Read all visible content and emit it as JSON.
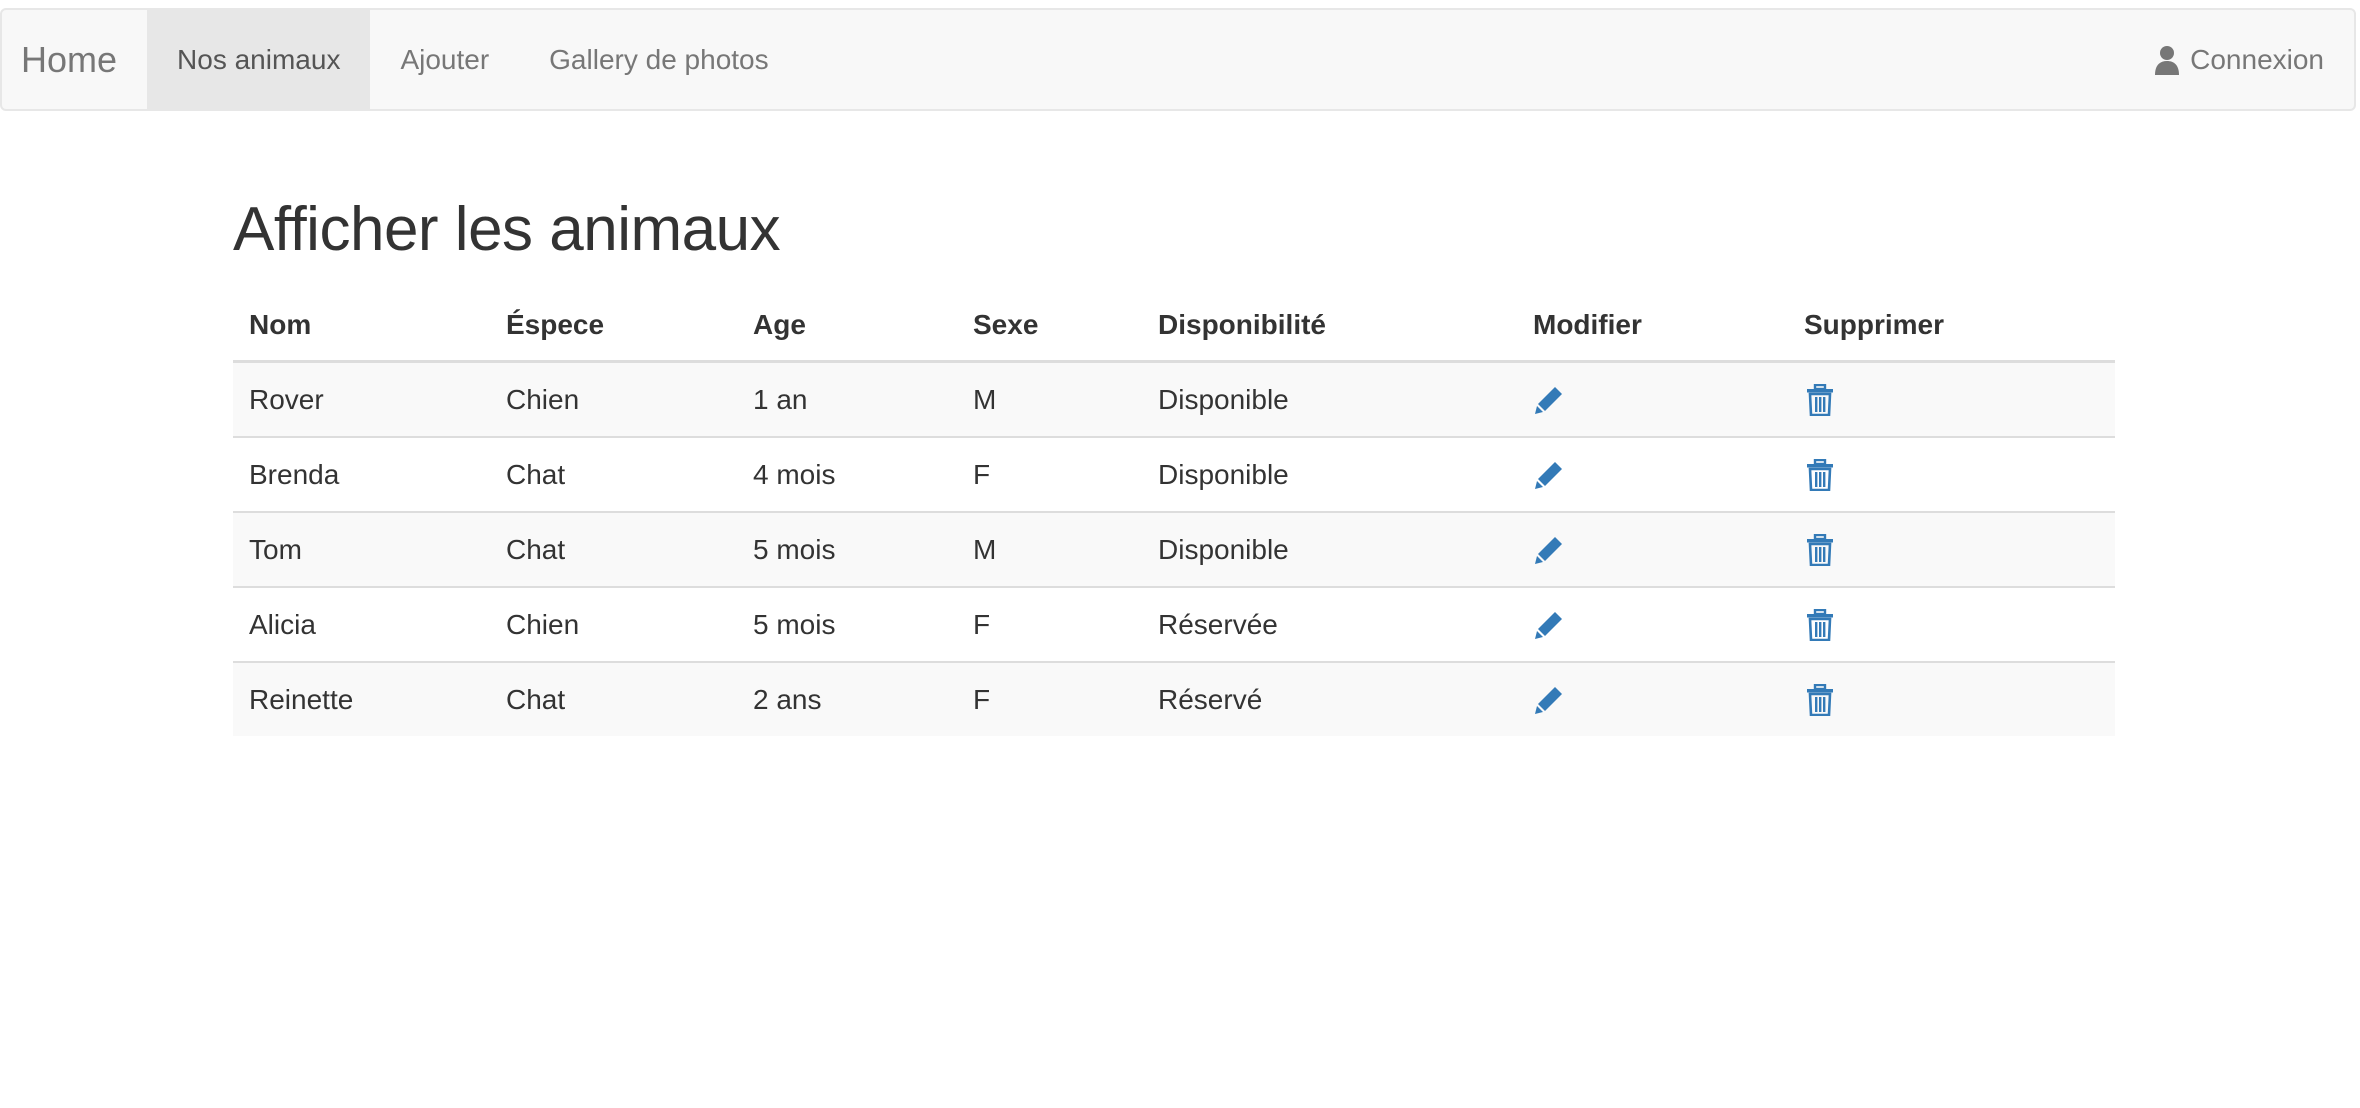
{
  "navbar": {
    "brand": "Home",
    "items": [
      {
        "label": "Nos animaux",
        "active": true
      },
      {
        "label": "Ajouter",
        "active": false
      },
      {
        "label": "Gallery de photos",
        "active": false
      }
    ],
    "login_label": "Connexion",
    "login_icon": "user-icon"
  },
  "main": {
    "title": "Afficher les animaux",
    "table": {
      "headers": [
        "Nom",
        "Éspece",
        "Age",
        "Sexe",
        "Disponibilité",
        "Modifier",
        "Supprimer"
      ],
      "rows": [
        {
          "nom": "Rover",
          "espece": "Chien",
          "age": "1 an",
          "sexe": "M",
          "disponibilite": "Disponible"
        },
        {
          "nom": "Brenda",
          "espece": "Chat",
          "age": "4 mois",
          "sexe": "F",
          "disponibilite": "Disponible"
        },
        {
          "nom": "Tom",
          "espece": "Chat",
          "age": "5 mois",
          "sexe": "M",
          "disponibilite": "Disponible"
        },
        {
          "nom": "Alicia",
          "espece": "Chien",
          "age": "5 mois",
          "sexe": "F",
          "disponibilite": "Réservée"
        },
        {
          "nom": "Reinette",
          "espece": "Chat",
          "age": "2 ans",
          "sexe": "F",
          "disponibilite": "Réservé"
        }
      ],
      "edit_icon": "pencil-icon",
      "delete_icon": "trash-icon"
    }
  },
  "colors": {
    "icon_blue": "#337ab7",
    "navbar_bg": "#f8f8f8",
    "active_tab_bg": "#e7e7e7",
    "stripe_bg": "#f9f9f9"
  }
}
